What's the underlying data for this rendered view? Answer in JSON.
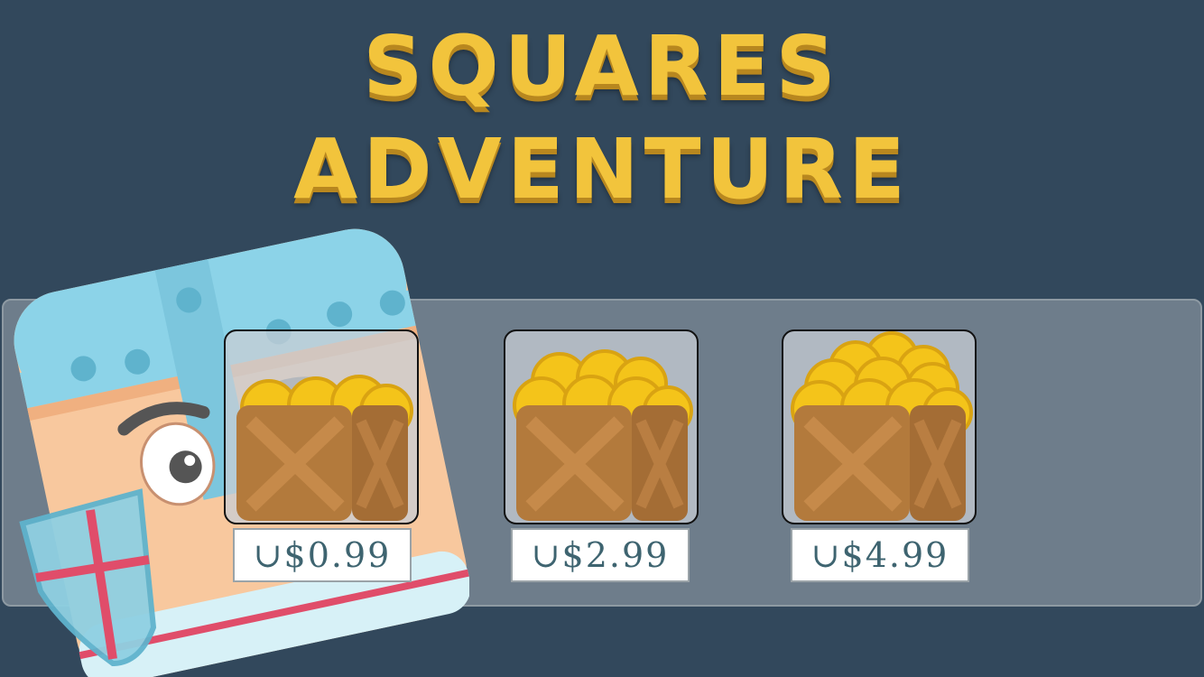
{
  "game": {
    "title_line1": "SQUARES",
    "title_line2": "ADVENTURE"
  },
  "shop": {
    "items": [
      {
        "price": "∪$0.99",
        "coin_level": "small"
      },
      {
        "price": "∪$2.99",
        "coin_level": "medium"
      },
      {
        "price": "∪$4.99",
        "coin_level": "large"
      }
    ]
  },
  "colors": {
    "background": "#32485c",
    "title": "#f2c43c",
    "price_text": "#3e6470"
  },
  "icons": [
    "knight-mascot",
    "coin-crate-icon",
    "shield-icon"
  ]
}
